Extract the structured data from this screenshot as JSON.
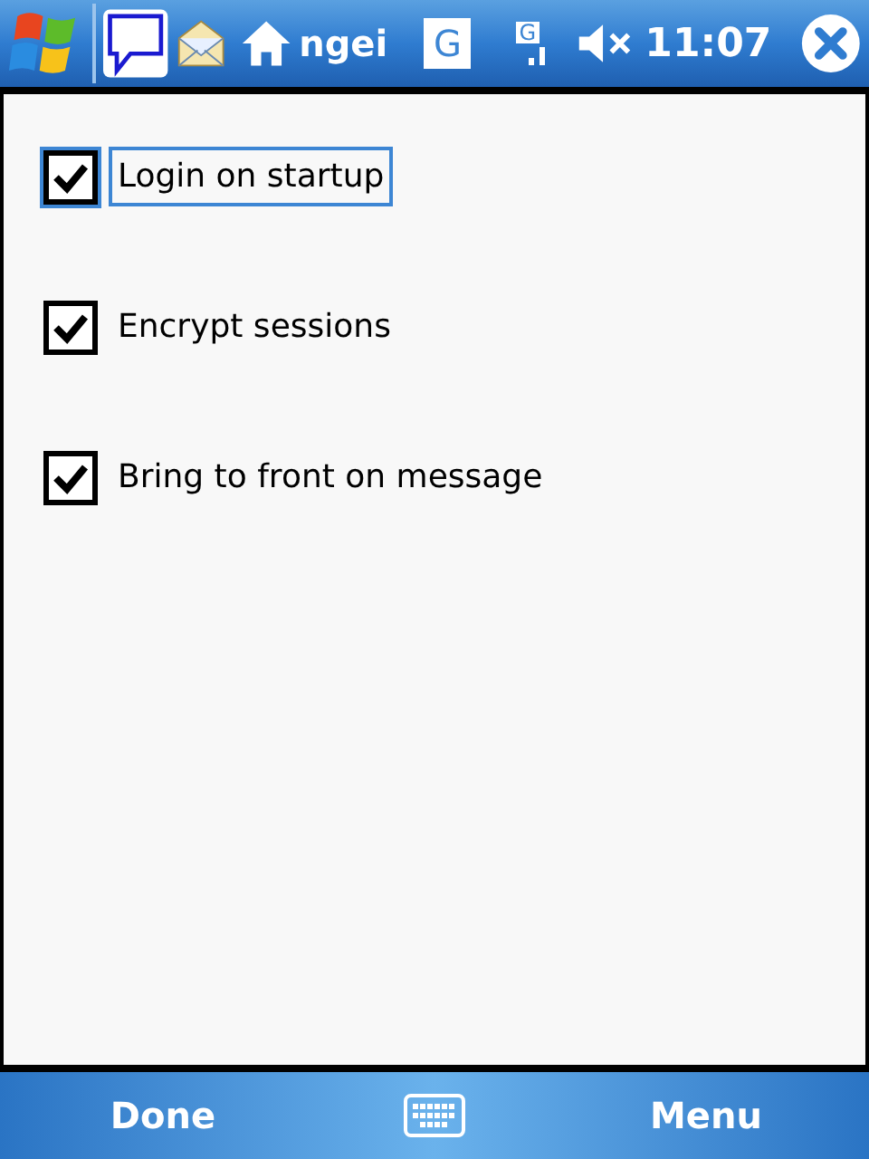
{
  "status_bar": {
    "app_label": "ngei",
    "network_badge": "G",
    "signal_badge": "G",
    "time": "11:07"
  },
  "options": [
    {
      "label": "Login on startup",
      "checked": true,
      "focused": true
    },
    {
      "label": "Encrypt sessions",
      "checked": true,
      "focused": false
    },
    {
      "label": "Bring to front on message",
      "checked": true,
      "focused": false
    }
  ],
  "softkeys": {
    "left": "Done",
    "right": "Menu"
  }
}
